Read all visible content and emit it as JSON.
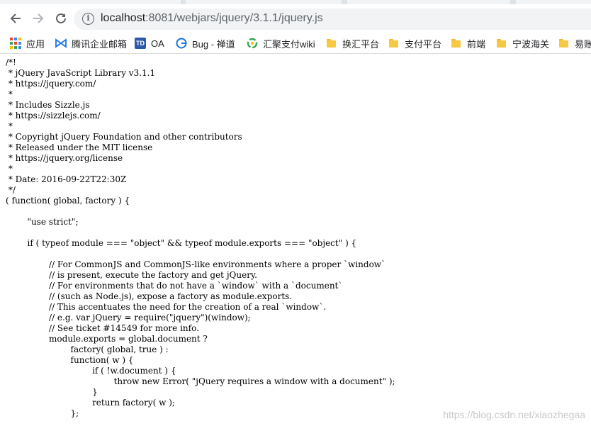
{
  "browser": {
    "url_host": "localhost",
    "url_rest": ":8081/webjars/jquery/3.1.1/jquery.js"
  },
  "bookmarks": [
    {
      "label": "应用",
      "icon": "apps-grid-icon"
    },
    {
      "label": "腾讯企业邮箱",
      "icon": "tencent-mail-icon"
    },
    {
      "label": "OA",
      "icon": "td-oa-icon"
    },
    {
      "label": "Bug - 禅道",
      "icon": "zentao-icon"
    },
    {
      "label": "汇聚支付wiki",
      "icon": "wiki-icon"
    },
    {
      "label": "换汇平台",
      "icon": "folder-icon"
    },
    {
      "label": "支付平台",
      "icon": "folder-icon"
    },
    {
      "label": "前端",
      "icon": "folder-icon"
    },
    {
      "label": "宁波海关",
      "icon": "folder-icon"
    },
    {
      "label": "易账",
      "icon": "folder-icon"
    }
  ],
  "icon_labels": {
    "td": "TD"
  },
  "code_lines": [
    "/*!",
    " * jQuery JavaScript Library v3.1.1",
    " * https://jquery.com/",
    " *",
    " * Includes Sizzle.js",
    " * https://sizzlejs.com/",
    " *",
    " * Copyright jQuery Foundation and other contributors",
    " * Released under the MIT license",
    " * https://jquery.org/license",
    " *",
    " * Date: 2016-09-22T22:30Z",
    " */",
    "( function( global, factory ) {",
    "",
    "\t\"use strict\";",
    "",
    "\tif ( typeof module === \"object\" && typeof module.exports === \"object\" ) {",
    "",
    "\t\t// For CommonJS and CommonJS-like environments where a proper `window`",
    "\t\t// is present, execute the factory and get jQuery.",
    "\t\t// For environments that do not have a `window` with a `document`",
    "\t\t// (such as Node.js), expose a factory as module.exports.",
    "\t\t// This accentuates the need for the creation of a real `window`.",
    "\t\t// e.g. var jQuery = require(\"jquery\")(window);",
    "\t\t// See ticket #14549 for more info.",
    "\t\tmodule.exports = global.document ?",
    "\t\t\tfactory( global, true ) :",
    "\t\t\tfunction( w ) {",
    "\t\t\t\tif ( !w.document ) {",
    "\t\t\t\t\tthrow new Error( \"jQuery requires a window with a document\" );",
    "\t\t\t\t}",
    "\t\t\t\treturn factory( w );",
    "\t\t\t};"
  ],
  "watermark": "https://blog.csdn.net/xiaozhegaa",
  "colors": {
    "tab_strip": "#dee1e6",
    "omnibox_bg": "#f1f3f4",
    "folder": "#f7c842",
    "text": "#000000"
  }
}
